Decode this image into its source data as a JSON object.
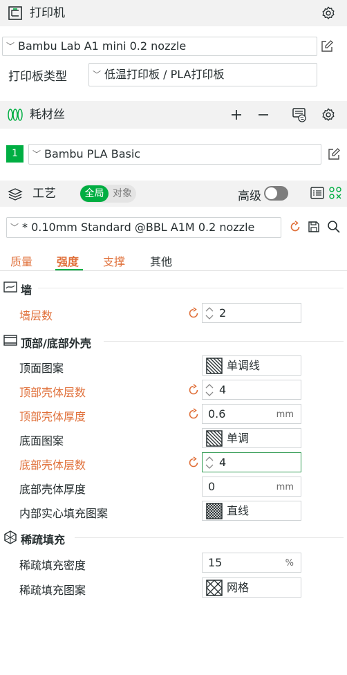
{
  "printer": {
    "title": "打印机",
    "preset": "Bambu Lab A1 mini 0.2 nozzle",
    "plate_label": "打印板类型",
    "plate_value": "低温打印板 / PLA打印板"
  },
  "filament": {
    "title": "耗材丝",
    "slot_number": "1",
    "preset": "Bambu PLA Basic"
  },
  "process": {
    "title": "工艺",
    "scope_global": "全局",
    "scope_object": "对象",
    "advanced_label": "高级",
    "advanced_on": false,
    "preset": "* 0.10mm Standard @BBL A1M 0.2 nozzle"
  },
  "tabs": [
    {
      "label": "质量",
      "state": "modified"
    },
    {
      "label": "强度",
      "state": "active"
    },
    {
      "label": "支撑",
      "state": "modified"
    },
    {
      "label": "其他",
      "state": "normal"
    }
  ],
  "sections": {
    "wall": {
      "title": "墙",
      "wall_loops": {
        "label": "墙层数",
        "value": "2"
      }
    },
    "shell": {
      "title": "顶部/底部外壳",
      "top_pattern": {
        "label": "顶面图案",
        "value": "单调线"
      },
      "top_layers": {
        "label": "顶部壳体层数",
        "value": "4"
      },
      "top_thickness": {
        "label": "顶部壳体厚度",
        "value": "0.6",
        "unit": "mm"
      },
      "bottom_pattern": {
        "label": "底面图案",
        "value": "单调"
      },
      "bottom_layers": {
        "label": "底部壳体层数",
        "value": "4"
      },
      "bottom_thickness": {
        "label": "底部壳体厚度",
        "value": "0",
        "unit": "mm"
      },
      "internal_pattern": {
        "label": "内部实心填充图案",
        "value": "直线"
      }
    },
    "infill": {
      "title": "稀疏填充",
      "density": {
        "label": "稀疏填充密度",
        "value": "15",
        "unit": "%"
      },
      "pattern": {
        "label": "稀疏填充图案",
        "value": "网格"
      }
    }
  },
  "colors": {
    "accent": "#00ae42",
    "modified": "#e0703a",
    "header_bg": "#f2f2f2"
  }
}
